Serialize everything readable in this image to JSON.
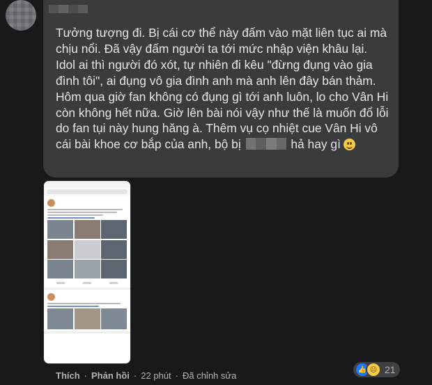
{
  "comment": {
    "text_before_redaction": "Tưởng tượng đi. Bị cái cơ thể này đấm vào mặt liên tục ai mà chịu nổi. Đã vậy đấm người ta tới mức nhập viện khâu lại. Idol ai thì người đó xót, tự nhiên đi kêu \"đừng đụng vào gia đình tôi\", ai đụng vô gia đình anh mà anh lên đây bán thảm. Hôm qua giờ fan không có đụng gì tới anh luôn, lo cho Vân Hi còn không hết nữa. Giờ lên bài nói vậy như thế là muốn đổ lỗi do fan tụi này hung hăng à. Thêm vụ cọ nhiệt cue Vân Hi vô cái bài khoe cơ bắp của anh, bộ bị",
    "text_after_redaction": "hả hay gì",
    "emoji": "smile-emoji"
  },
  "actions": {
    "like": "Thích",
    "reply": "Phản hồi",
    "time": "22 phút",
    "edited": "Đã chỉnh sửa",
    "separator": "·"
  },
  "reactions": {
    "icons": [
      "like-icon",
      "sad-icon"
    ],
    "count": "21"
  },
  "colors": {
    "background": "#18191a",
    "bubble": "#3a3b3c",
    "text": "#e4e6eb",
    "secondary": "#b0b3b8",
    "like_blue": "#2078f4"
  }
}
